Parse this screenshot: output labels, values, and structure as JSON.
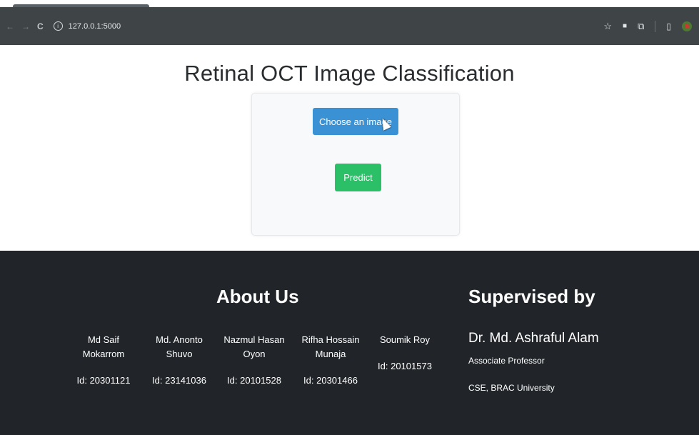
{
  "browser": {
    "url": "127.0.0.1:5000",
    "nav_back": "←",
    "nav_forward": "→",
    "reload": "C"
  },
  "page": {
    "title": "Retinal OCT Image Classification",
    "choose_label": "Choose an image",
    "predict_label": "Predict"
  },
  "footer": {
    "about_title": "About Us",
    "supervised_title": "Supervised by",
    "members": [
      {
        "name_line1": "Md Saif",
        "name_line2": "Mokarrom",
        "id": "Id: 20301121"
      },
      {
        "name_line1": "Md. Anonto",
        "name_line2": "Shuvo",
        "id": "Id: 23141036"
      },
      {
        "name_line1": "Nazmul Hasan",
        "name_line2": "Oyon",
        "id": "Id: 20101528"
      },
      {
        "name_line1": "Rifha Hossain",
        "name_line2": "Munaja",
        "id": "Id: 20301466"
      },
      {
        "name_line1": "Soumik Roy",
        "name_line2": "",
        "id": "Id: 20101573"
      }
    ],
    "supervisor": {
      "name": "Dr. Md. Ashraful Alam",
      "position": "Associate Professor",
      "department": "CSE, BRAC University"
    }
  },
  "colors": {
    "choose_button": "#3a92d5",
    "predict_button": "#2bbf67",
    "footer_bg": "#212529",
    "browser_bar": "#3f4447"
  }
}
